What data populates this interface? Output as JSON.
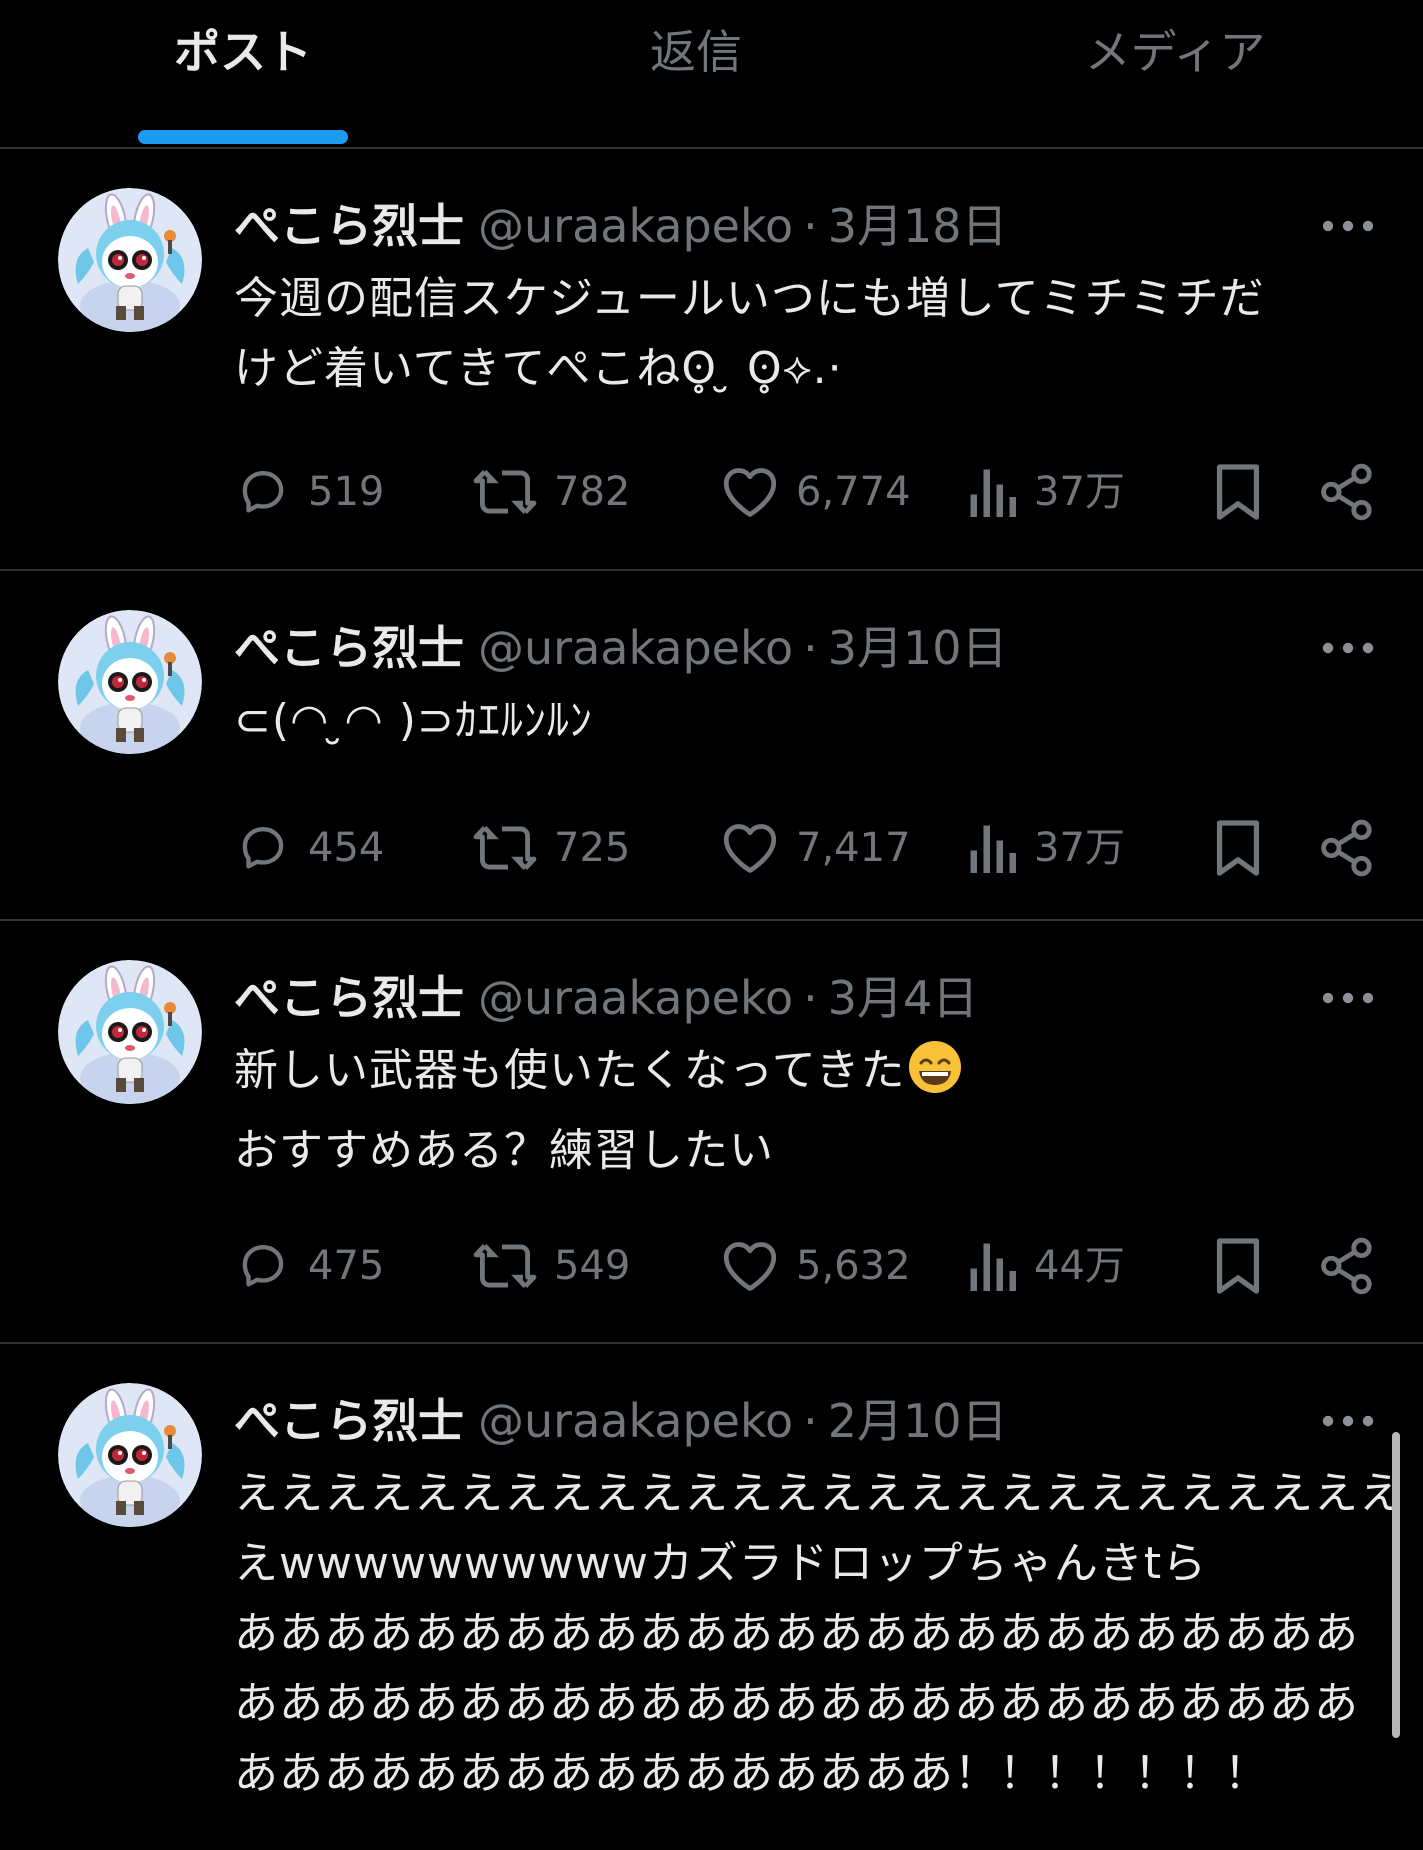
{
  "tabs": [
    {
      "label": "ポスト",
      "active": true
    },
    {
      "label": "返信",
      "active": false
    },
    {
      "label": "メディア",
      "active": false
    }
  ],
  "accent_color": "#1d9bf0",
  "icons": {
    "reply": "comment-bubble-icon",
    "repost": "repost-arrows-icon",
    "like": "heart-icon",
    "views": "bar-chart-icon",
    "bookmark": "bookmark-icon",
    "share": "share-icon",
    "more": "more-dots-icon"
  },
  "posts": [
    {
      "author": "ぺこら烈士",
      "handle": "@uraakapeko",
      "separator": "·",
      "date": "3月18日",
      "text_lines": [
        "今週の配信スケジュールいつにも増してミチミチだ",
        "けど着いてきてぺこねʘ̥ ̮ ʘ̥⟡.·"
      ],
      "replies": "519",
      "reposts": "782",
      "likes": "6,774",
      "views": "37万"
    },
    {
      "author": "ぺこら烈士",
      "handle": "@uraakapeko",
      "separator": "·",
      "date": "3月10日",
      "text_lines": [
        "⊂(◠ ̮◠ )⊃ｶｴﾙﾝﾙﾝ"
      ],
      "replies": "454",
      "reposts": "725",
      "likes": "7,417",
      "views": "37万"
    },
    {
      "author": "ぺこら烈士",
      "handle": "@uraakapeko",
      "separator": "·",
      "date": "3月4日",
      "text_lines": [
        "新しい武器も使いたくなってきた",
        "おすすめある？練習したい"
      ],
      "emoji": "grinning-face-emoji",
      "replies": "475",
      "reposts": "549",
      "likes": "5,632",
      "views": "44万"
    },
    {
      "author": "ぺこら烈士",
      "handle": "@uraakapeko",
      "separator": "·",
      "date": "2月10日",
      "text_lines": [
        "ええええええええええええええええええええええええええ",
        "えwwwwwwwwwwカズラドロップちゃんきtら",
        "あああああああああああああああああああああああああ",
        "あああああああああああああああああああああああああ",
        "ああああああああああああああああ！！！！！！！"
      ]
    }
  ]
}
